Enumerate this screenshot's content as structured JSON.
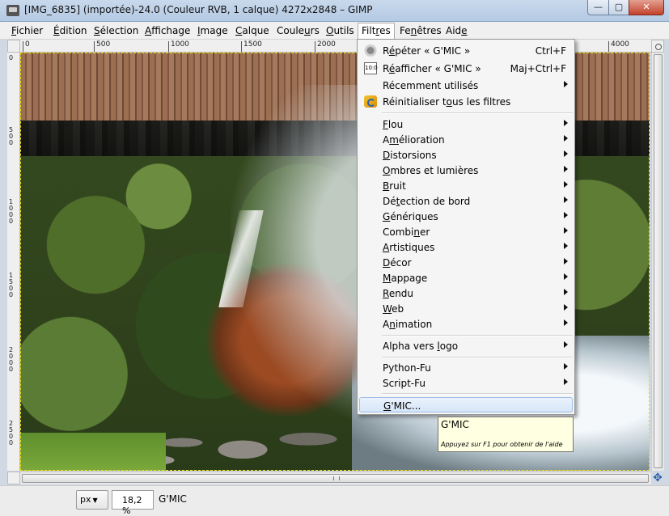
{
  "window": {
    "title": "[IMG_6835] (importée)-24.0 (Couleur RVB, 1 calque) 4272x2848 – GIMP",
    "minimize_glyph": "—",
    "maximize_glyph": "▢",
    "close_glyph": "✕"
  },
  "menubar": {
    "items": [
      {
        "pre": "",
        "u": "F",
        "post": "ichier"
      },
      {
        "pre": "",
        "u": "É",
        "post": "dition"
      },
      {
        "pre": "",
        "u": "S",
        "post": "élection"
      },
      {
        "pre": "",
        "u": "A",
        "post": "ffichage"
      },
      {
        "pre": "",
        "u": "I",
        "post": "mage"
      },
      {
        "pre": "",
        "u": "C",
        "post": "alque"
      },
      {
        "pre": "Coule",
        "u": "u",
        "post": "rs"
      },
      {
        "pre": "",
        "u": "O",
        "post": "utils"
      },
      {
        "pre": "Filt",
        "u": "r",
        "post": "es"
      },
      {
        "pre": "Fe",
        "u": "n",
        "post": "êtres"
      },
      {
        "pre": "Aid",
        "u": "e",
        "post": ""
      }
    ]
  },
  "rulers": {
    "top_labels": [
      "0",
      "500",
      "1000",
      "1500",
      "2000",
      "4000"
    ],
    "left_labels": [
      "0",
      "5 0 0",
      "1 0 0 0",
      "1 5 0 0",
      "2 0 0 0",
      "2 5 0 0"
    ]
  },
  "filters_menu": {
    "repeat": {
      "pre": "R",
      "u": "é",
      "post": "péter « G'MIC »",
      "accel": "Ctrl+F"
    },
    "reshow": {
      "pre": "R",
      "u": "é",
      "post": "afficher « G'MIC »",
      "accel": "Maj+Ctrl+F"
    },
    "recent": {
      "pre": "Récemment utilisés",
      "u": "",
      "post": ""
    },
    "reset": {
      "pre": "Réinitialiser t",
      "u": "o",
      "post": "us les filtres"
    },
    "reshow_icon_text": "10:0",
    "groups": [
      {
        "pre": "",
        "u": "F",
        "post": "lou"
      },
      {
        "pre": "A",
        "u": "m",
        "post": "élioration"
      },
      {
        "pre": "",
        "u": "D",
        "post": "istorsions"
      },
      {
        "pre": "",
        "u": "O",
        "post": "mbres et lumières"
      },
      {
        "pre": "",
        "u": "B",
        "post": "ruit"
      },
      {
        "pre": "Dé",
        "u": "t",
        "post": "ection de bord"
      },
      {
        "pre": "",
        "u": "G",
        "post": "énériques"
      },
      {
        "pre": "Combi",
        "u": "n",
        "post": "er"
      },
      {
        "pre": "",
        "u": "A",
        "post": "rtistiques"
      },
      {
        "pre": "",
        "u": "D",
        "post": "écor"
      },
      {
        "pre": "",
        "u": "M",
        "post": "appage"
      },
      {
        "pre": "",
        "u": "R",
        "post": "endu"
      },
      {
        "pre": "",
        "u": "W",
        "post": "eb"
      },
      {
        "pre": "A",
        "u": "n",
        "post": "imation"
      }
    ],
    "alpha": {
      "pre": "Alpha vers ",
      "u": "l",
      "post": "ogo"
    },
    "python": {
      "pre": "Python-Fu",
      "u": "",
      "post": ""
    },
    "script": {
      "pre": "Script-Fu",
      "u": "",
      "post": ""
    },
    "gmic": {
      "pre": "",
      "u": "G",
      "post": "'MIC..."
    }
  },
  "tooltip": {
    "title": "G'MIC",
    "hint": "Appuyez sur F1 pour obtenir de l'aide"
  },
  "statusbar": {
    "unit": "px",
    "zoom": "18,2 %",
    "message": "G'MIC"
  }
}
